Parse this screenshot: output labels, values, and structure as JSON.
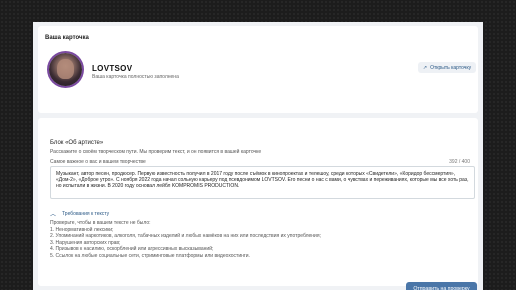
{
  "card": {
    "title": "Ваша карточка",
    "name": "LOVTSOV",
    "status": "Ваша карточка полностью заполнена",
    "open_button": "Открыть карточку",
    "open_icon": "arrow-up-right-icon"
  },
  "about": {
    "title": "Блок «Об артисте»",
    "description": "Расскажите о своём творческом пути. Мы проверим текст, и он появится в вашей карточке",
    "field_label": "Самое важное о вас и вашем творчестве",
    "counter": "392 / 400",
    "text": "Музыкант, автор песен, продюсер. Первую известность получил в 2017 году после съёмок в кинопроектах и телешоу, среди которых «Свидетели», «Коридор бессмертия», «Дом-2», «Доброе утро». С ноября 2022 года начал сольную карьеру под псевдонимом LOVTSOV. Его песни о нас с вами, о чувствах и переживаниях, которые мы все хоть раз, но испытали в жизни. В 2020 году основал лейбл KOMPROMIS PRODUCTION.",
    "requirements_toggle": "Требования к тексту",
    "requirements_intro": "Проверьте, чтобы в вашем тексте не было:",
    "requirements": [
      "1. Ненормативной лексики;",
      "2. Упоминаний наркотиков, алкоголя, табачных изделий и любых намёков на них или последствия их употребления;",
      "3. Нарушения авторских прав;",
      "4. Призывов к насилию, оскорблений или агрессивных высказываний;",
      "5. Ссылок на любые социальные сети, стриминговые платформы или видеохостинги."
    ],
    "submit_button": "Отправить на проверку"
  },
  "colors": {
    "accent": "#4a76a8",
    "link": "#2a5885",
    "panel_bg": "#f0f2f5",
    "avatar_ring": "#7a4aa0"
  }
}
